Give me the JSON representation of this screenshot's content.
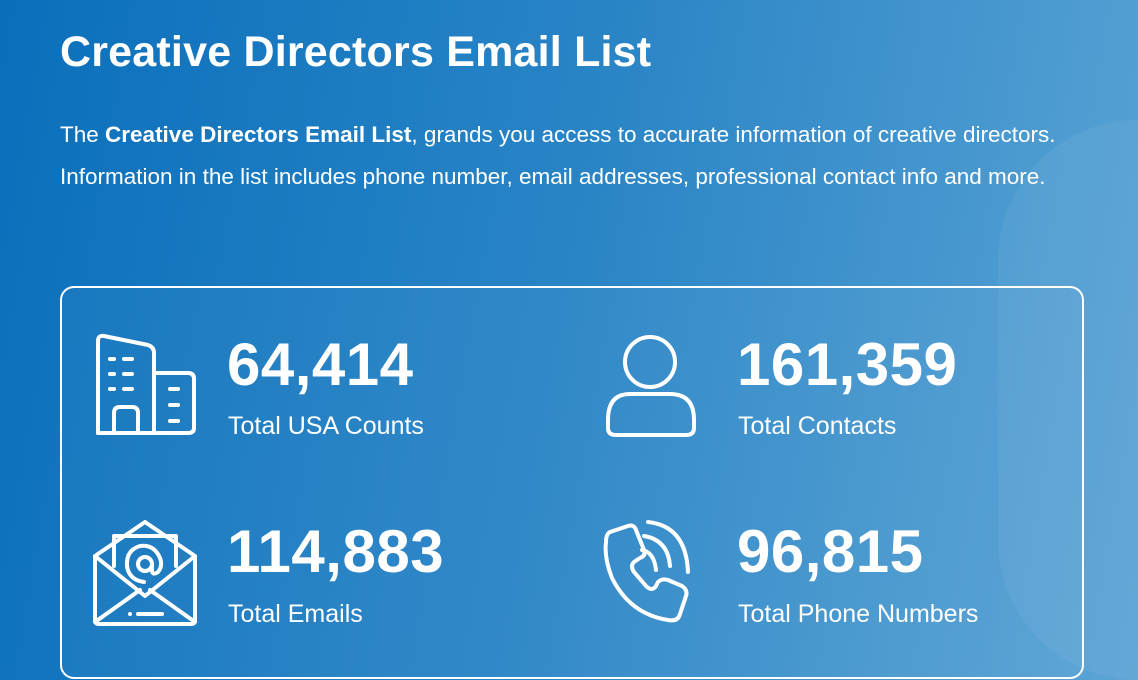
{
  "title": "Creative Directors Email List",
  "description": {
    "prefix": "The ",
    "bold": "Creative Directors Email List",
    "rest": ", grands you access to accurate information of creative directors. Information in the list includes phone number, email addresses, professional contact info and more."
  },
  "stats": [
    {
      "value": "64,414",
      "label": "Total USA Counts",
      "icon": "building-icon"
    },
    {
      "value": "161,359",
      "label": "Total Contacts",
      "icon": "user-icon"
    },
    {
      "value": "114,883",
      "label": "Total Emails",
      "icon": "email-open-icon"
    },
    {
      "value": "96,815",
      "label": "Total Phone Numbers",
      "icon": "phone-call-icon"
    }
  ],
  "colors": {
    "background_start": "#0a6fbb",
    "background_end": "#5ba4d5",
    "text": "#ffffff"
  }
}
